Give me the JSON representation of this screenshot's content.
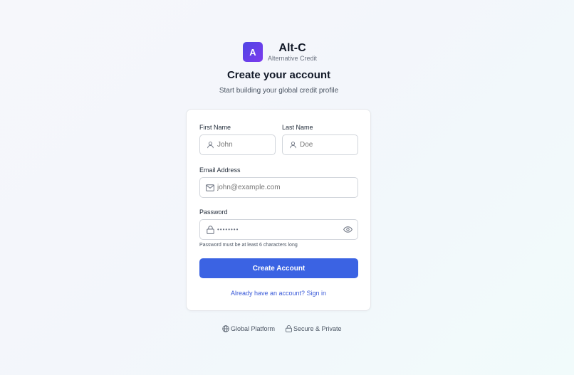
{
  "brand": {
    "logo_letter": "A",
    "name": "Alt-C",
    "tagline": "Alternative Credit",
    "logo_gradient": [
      "#4f46e5",
      "#7c3aed"
    ]
  },
  "header": {
    "title": "Create your account",
    "subtitle": "Start building your global credit profile"
  },
  "form": {
    "first_name": {
      "label": "First Name",
      "placeholder": "John",
      "value": "",
      "icon": "user-icon"
    },
    "last_name": {
      "label": "Last Name",
      "placeholder": "Doe",
      "value": "",
      "icon": "user-icon"
    },
    "email": {
      "label": "Email Address",
      "placeholder": "john@example.com",
      "value": "",
      "icon": "mail-icon"
    },
    "password": {
      "label": "Password",
      "masked_value": "••••••••",
      "icon": "lock-icon",
      "toggle_icon": "eye-icon",
      "hint": "Password must be at least 6 characters long"
    },
    "submit_label": "Create Account",
    "signin_link": "Already have an account? Sign in"
  },
  "footer": {
    "items": [
      {
        "label": "Global Platform",
        "icon": "globe-icon"
      },
      {
        "label": "Secure & Private",
        "icon": "lock-icon"
      }
    ]
  },
  "colors": {
    "primary": "#3b63e3",
    "link": "#3b5bd9",
    "border": "#d1d5db"
  }
}
